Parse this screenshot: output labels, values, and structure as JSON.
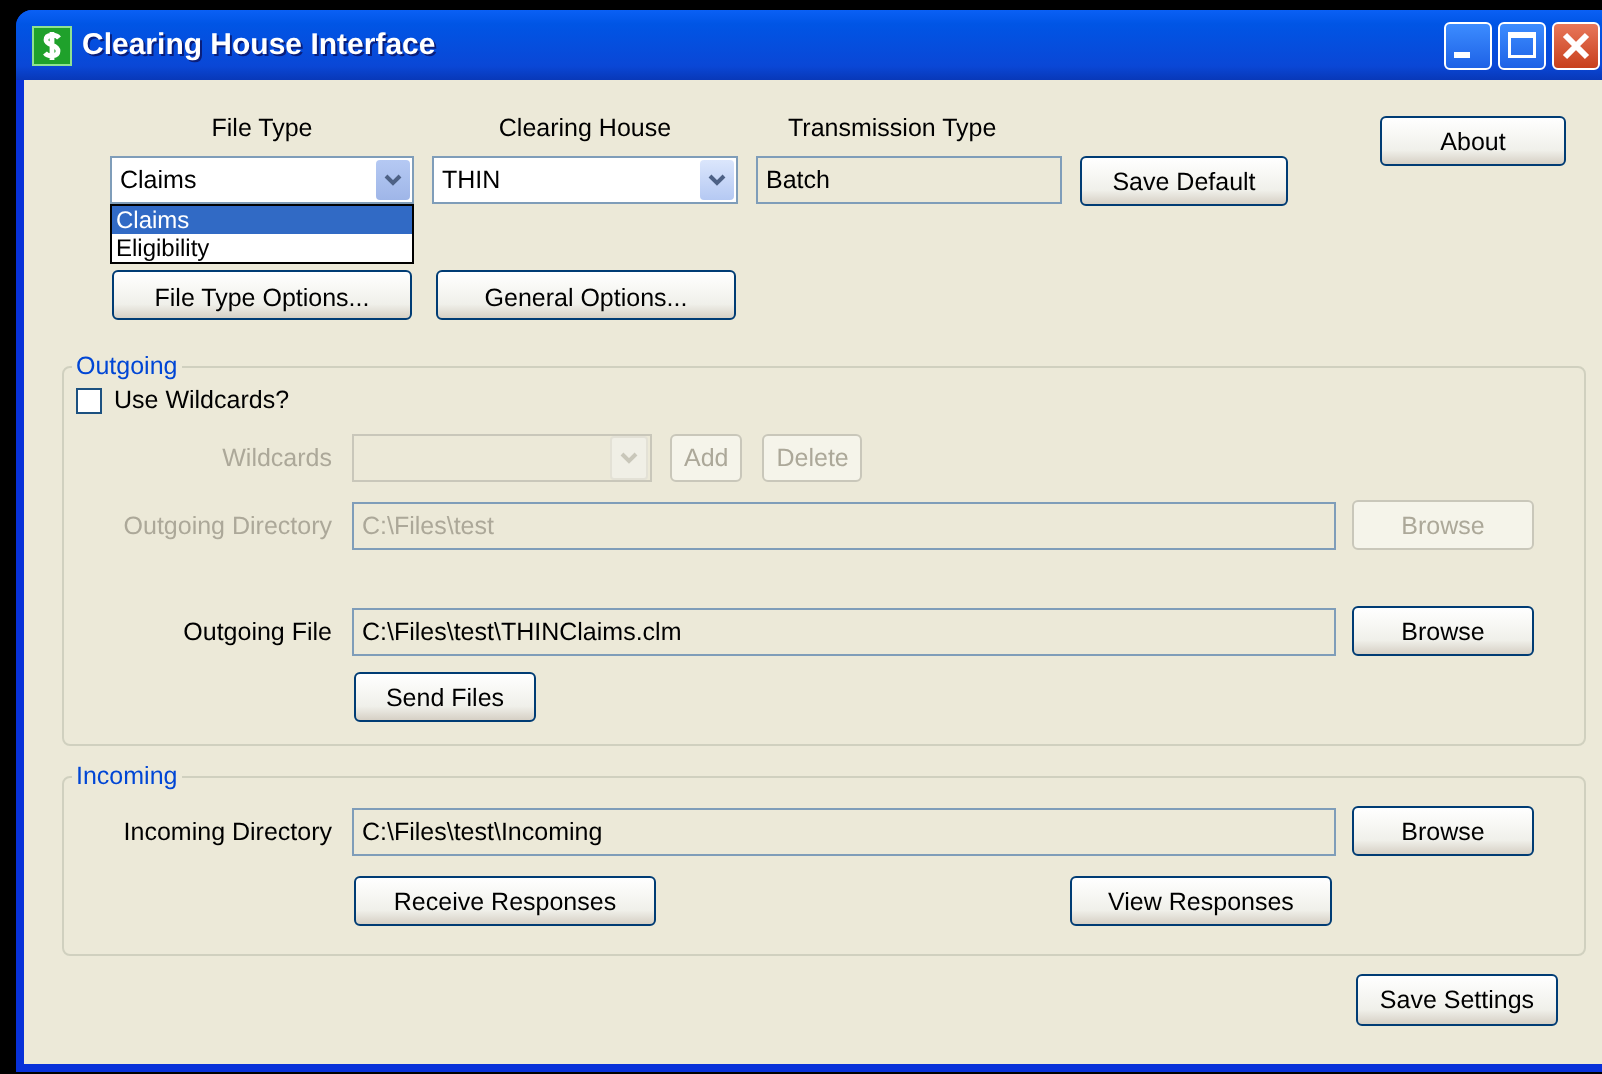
{
  "window": {
    "title": "Clearing House Interface"
  },
  "top": {
    "fields": [
      {
        "kind": "combo",
        "label": "File Type",
        "value": "Claims",
        "expanded": true,
        "options": [
          {
            "label": "Claims",
            "selected": true
          },
          {
            "label": "Eligibility",
            "selected": false
          }
        ]
      },
      {
        "kind": "combo",
        "label": "Clearing House",
        "value": "THIN",
        "expanded": false
      },
      {
        "kind": "text",
        "label": "Transmission Type",
        "value": "Batch"
      }
    ],
    "save_default": {
      "label": "Save Default"
    },
    "about": {
      "label": "About"
    },
    "option_buttons": [
      {
        "label": "File Type Options..."
      },
      {
        "label": "General Options..."
      }
    ]
  },
  "outgoing": {
    "title": "Outgoing",
    "use_wildcards": {
      "label": "Use Wildcards?",
      "checked": false
    },
    "wildcards": {
      "label": "Wildcards",
      "disabled": true,
      "buttons": [
        {
          "label": "Add"
        },
        {
          "label": "Delete"
        }
      ]
    },
    "directory": {
      "label": "Outgoing Directory",
      "value": "C:\\Files\\test",
      "disabled": true,
      "button": {
        "label": "Browse"
      }
    },
    "file": {
      "label": "Outgoing File",
      "value": "C:\\Files\\test\\THINClaims.clm",
      "disabled": false,
      "button": {
        "label": "Browse"
      }
    },
    "send": {
      "label": "Send Files"
    }
  },
  "incoming": {
    "title": "Incoming",
    "directory": {
      "label": "Incoming Directory",
      "value": "C:\\Files\\test\\Incoming",
      "button": {
        "label": "Browse"
      }
    },
    "receive": {
      "label": "Receive Responses"
    },
    "view": {
      "label": "View Responses"
    }
  },
  "save_settings": {
    "label": "Save Settings"
  }
}
